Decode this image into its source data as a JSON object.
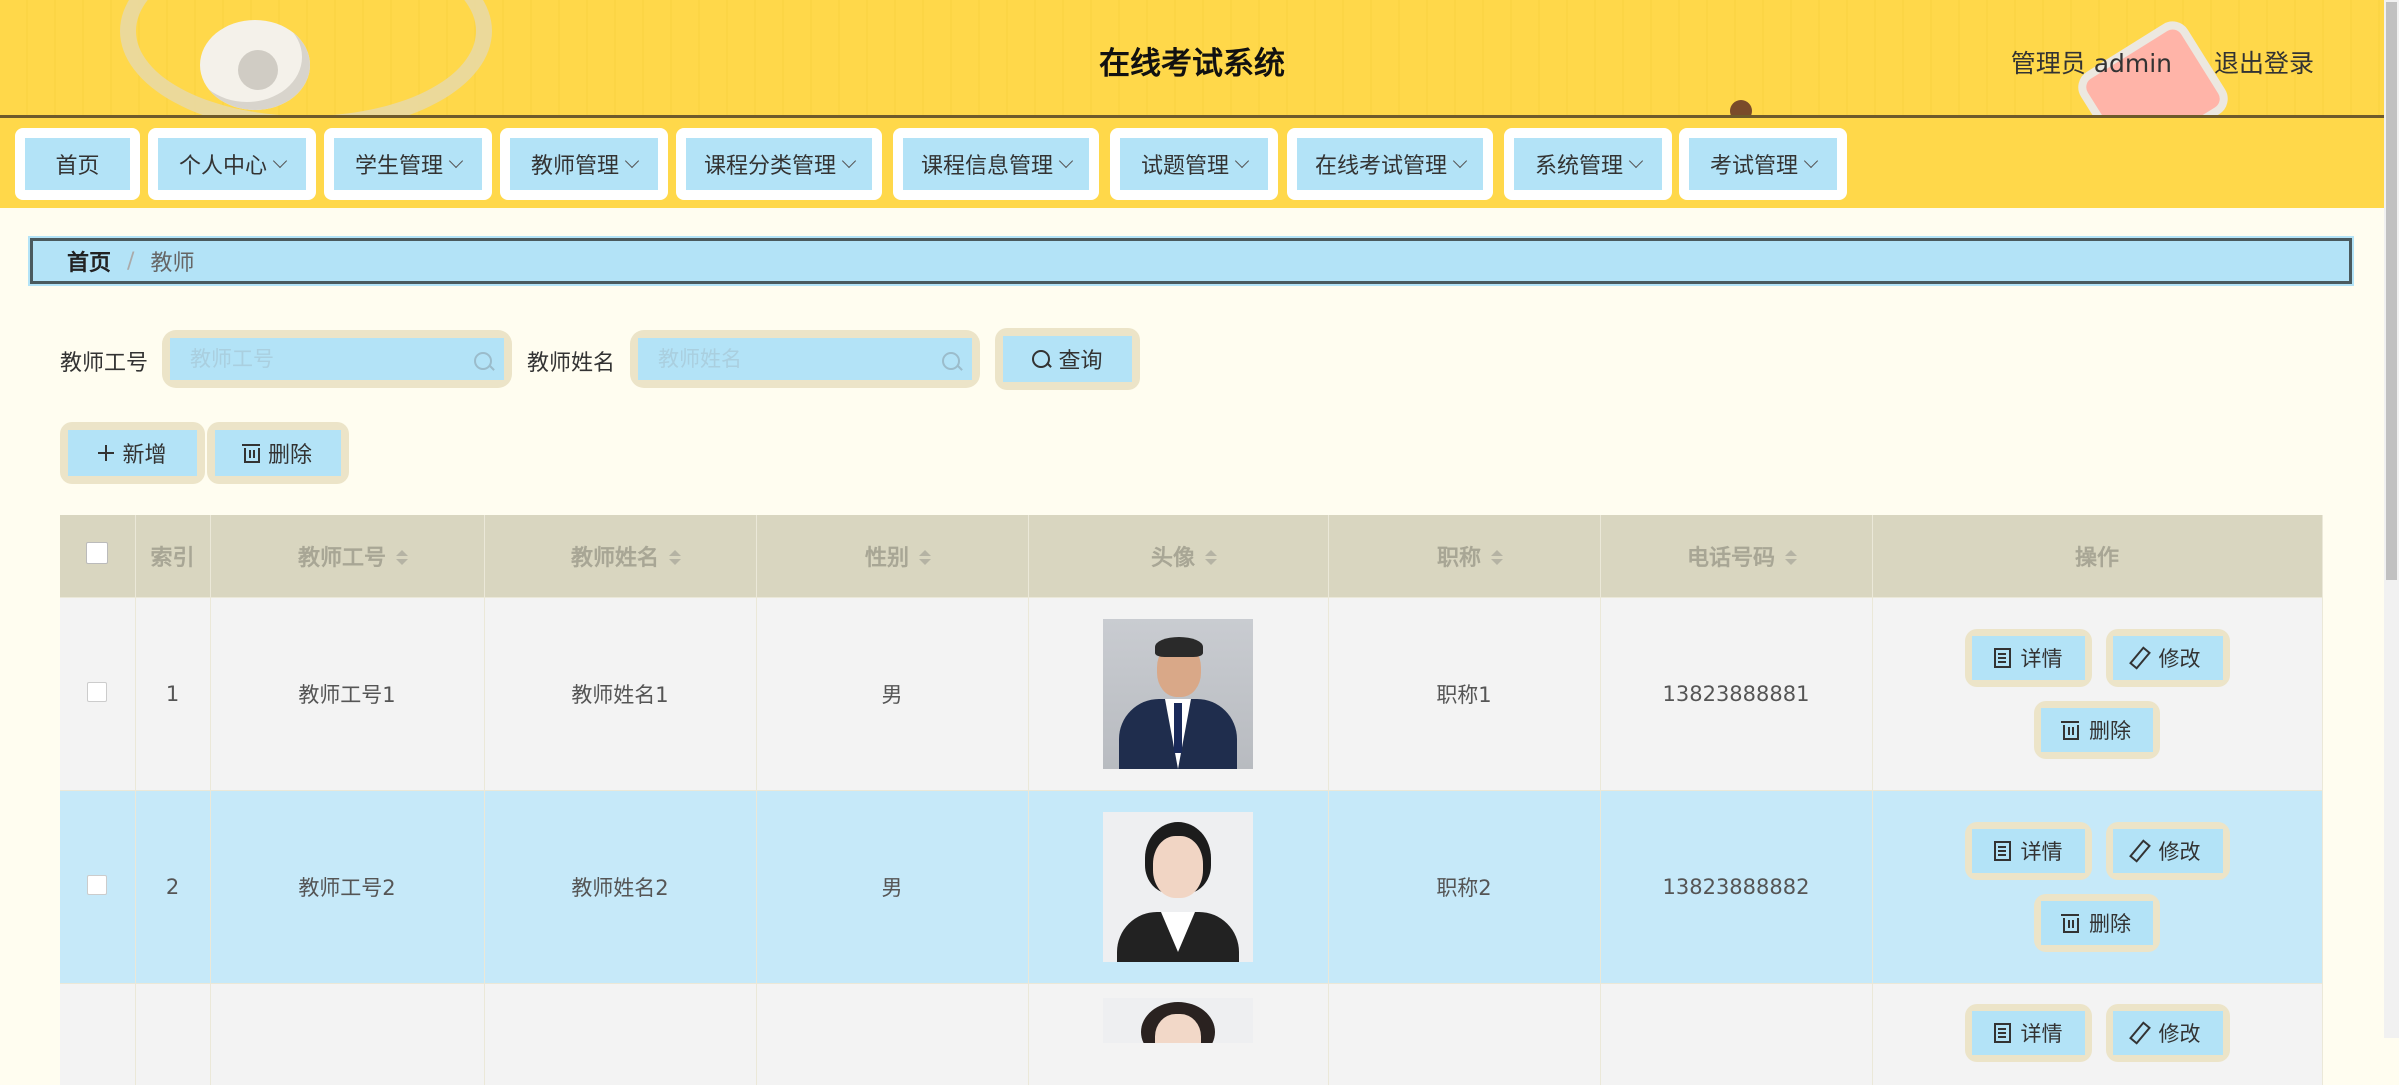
{
  "header": {
    "title": "在线考试系统",
    "user": "管理员 admin",
    "logout": "退出登录"
  },
  "nav": [
    {
      "label": "首页",
      "dropdown": false
    },
    {
      "label": "个人中心",
      "dropdown": true
    },
    {
      "label": "学生管理",
      "dropdown": true
    },
    {
      "label": "教师管理",
      "dropdown": true
    },
    {
      "label": "课程分类管理",
      "dropdown": true
    },
    {
      "label": "课程信息管理",
      "dropdown": true
    },
    {
      "label": "试题管理",
      "dropdown": true
    },
    {
      "label": "在线考试管理",
      "dropdown": true
    },
    {
      "label": "系统管理",
      "dropdown": true
    },
    {
      "label": "考试管理",
      "dropdown": true
    }
  ],
  "breadcrumb": {
    "home": "首页",
    "separator": "/",
    "current": "教师"
  },
  "search": {
    "id_label": "教师工号",
    "id_placeholder": "教师工号",
    "name_label": "教师姓名",
    "name_placeholder": "教师姓名",
    "query_button": "查询"
  },
  "actions": {
    "add": "新增",
    "delete": "删除"
  },
  "table": {
    "columns": [
      "索引",
      "教师工号",
      "教师姓名",
      "性别",
      "头像",
      "职称",
      "电话号码",
      "操作"
    ],
    "rows": [
      {
        "index": "1",
        "id": "教师工号1",
        "name": "教师姓名1",
        "gender": "男",
        "title": "职称1",
        "phone": "13823888881"
      },
      {
        "index": "2",
        "id": "教师工号2",
        "name": "教师姓名2",
        "gender": "男",
        "title": "职称2",
        "phone": "13823888882"
      }
    ],
    "ops": {
      "detail": "详情",
      "edit": "修改",
      "delete": "删除"
    }
  },
  "colors": {
    "header_bg": "#ffd84a",
    "button_bg": "#b3e3f7",
    "button_frame": "#ece4c8",
    "page_bg": "#fffdf0",
    "table_head": "#d9d6c0",
    "row_highlight": "#c6e9f9"
  }
}
